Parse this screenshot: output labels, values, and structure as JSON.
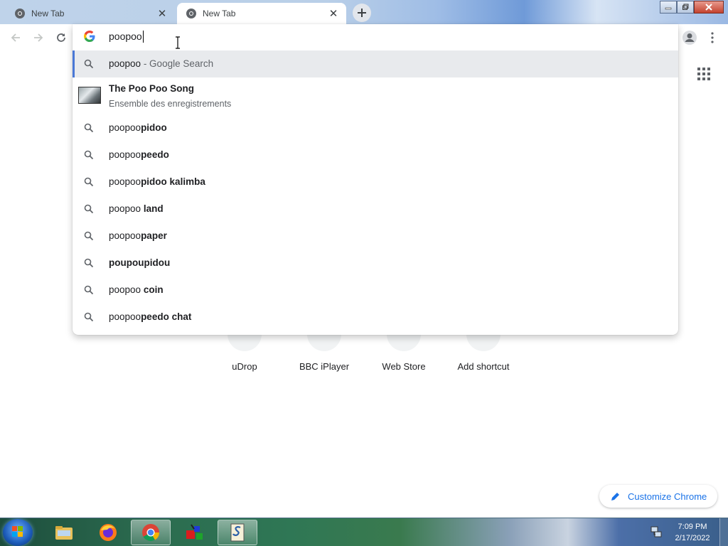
{
  "browser": {
    "tabs": [
      {
        "title": "New Tab",
        "state": "inactive"
      },
      {
        "title": "New Tab",
        "state": "active"
      }
    ]
  },
  "omnibox": {
    "input_value": "poopoo",
    "suggestions": [
      {
        "typed": "poopoo",
        "rest": "",
        "suffix": " - Google Search",
        "selected": true
      },
      {
        "entity_title": "The Poo Poo Song",
        "entity_subtitle": "Ensemble des enregistrements"
      },
      {
        "typed": "poopoo",
        "rest": "pidoo"
      },
      {
        "typed": "poopoo",
        "rest": "peedo"
      },
      {
        "typed": "poopoo",
        "rest": "pidoo kalimba"
      },
      {
        "typed": "poopoo ",
        "rest": "land"
      },
      {
        "typed": "poopoo",
        "rest": "paper"
      },
      {
        "typed": "",
        "rest": "poupoupidou"
      },
      {
        "typed": "poopoo ",
        "rest": "coin"
      },
      {
        "typed": "poopoo",
        "rest": "peedo chat"
      }
    ]
  },
  "shortcuts": [
    {
      "label": "uDrop"
    },
    {
      "label": "BBC iPlayer"
    },
    {
      "label": "Web Store"
    },
    {
      "label": "Add shortcut"
    }
  ],
  "customize_label": "Customize Chrome",
  "taskbar": {
    "items": [
      {
        "name": "windows-explorer",
        "active": false
      },
      {
        "name": "firefox",
        "active": false
      },
      {
        "name": "chrome",
        "active": true
      },
      {
        "name": "paint-app",
        "active": false
      },
      {
        "name": "scripts-app",
        "active": true
      }
    ],
    "clock": {
      "time": "7:09 PM",
      "date": "2/17/2022"
    }
  },
  "colors": {
    "accent": "#1a73e8",
    "selected_row": "#e8eaed",
    "selection_bar": "#4a78d6"
  }
}
